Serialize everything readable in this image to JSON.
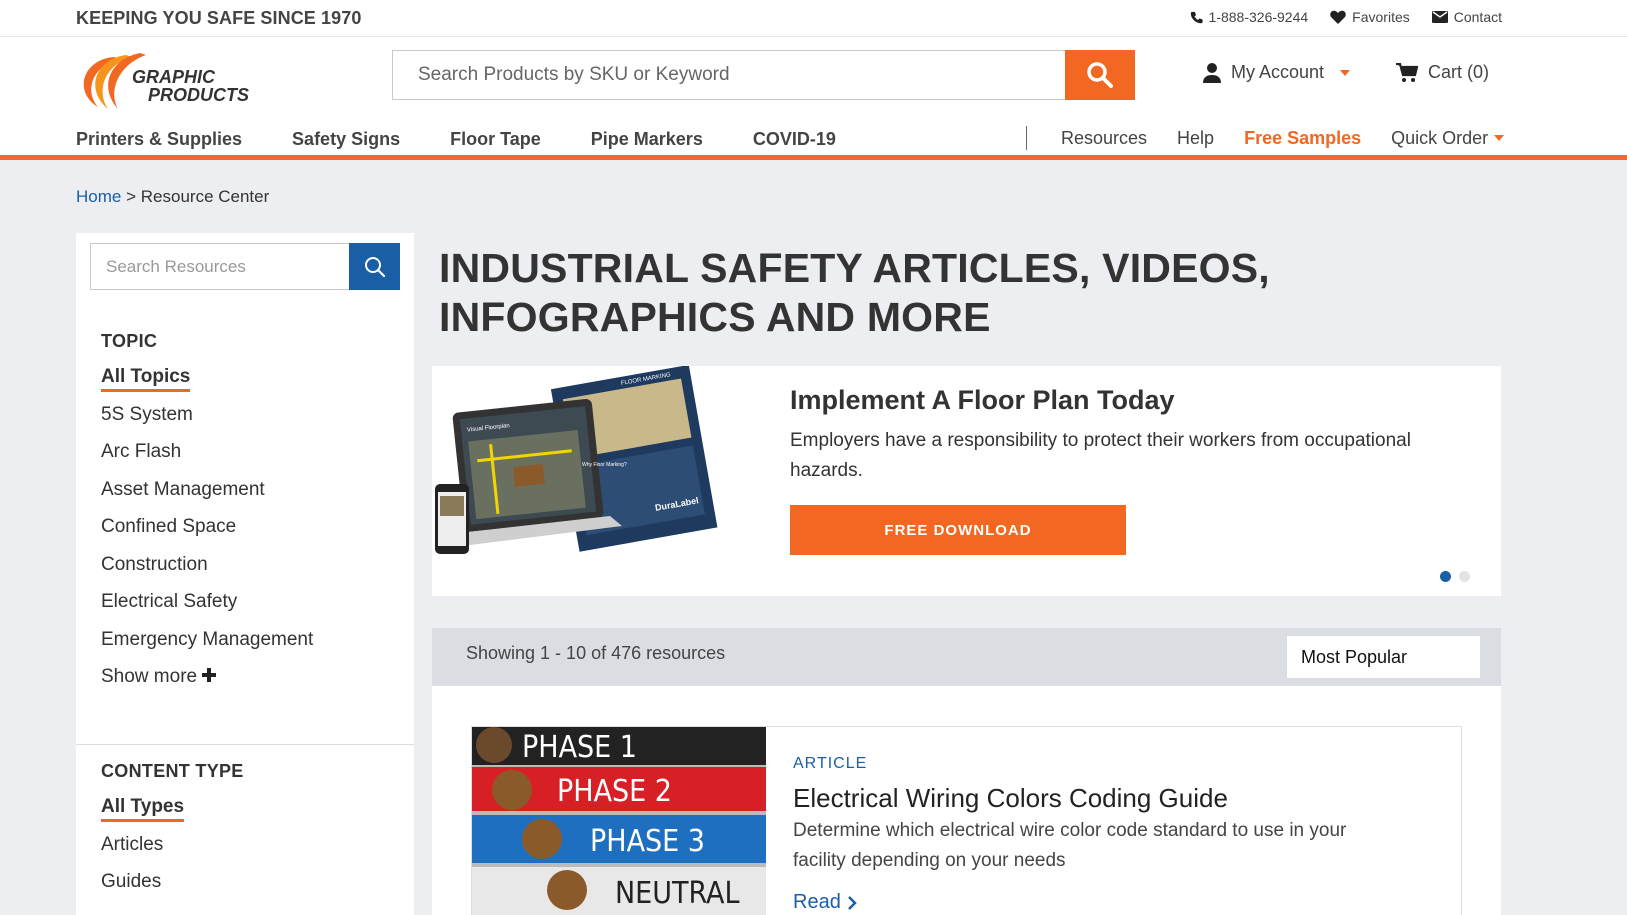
{
  "brand": {
    "tagline": "KEEPING YOU SAFE SINCE 1970",
    "logo_line1": "GRAPHIC",
    "logo_line2": "PRODUCTS",
    "accent": "#f26722",
    "link": "#1a5fa6"
  },
  "toplinks": {
    "phone": "1-888-326-9244",
    "favorites": "Favorites",
    "contact": "Contact"
  },
  "header": {
    "search_placeholder": "Search Products by SKU or Keyword",
    "account": "My Account",
    "cart": "Cart (0)"
  },
  "nav": {
    "main": [
      "Printers & Supplies",
      "Safety Signs",
      "Floor Tape",
      "Pipe Markers",
      "COVID-19"
    ],
    "secondary": [
      "Resources",
      "Help",
      "Free Samples",
      "Quick Order"
    ]
  },
  "breadcrumb": {
    "home": "Home",
    "separator": ">",
    "current": "Resource Center"
  },
  "sidebar": {
    "search_placeholder": "Search Resources",
    "topic_title": "TOPIC",
    "topics": [
      "All Topics",
      "5S System",
      "Arc Flash",
      "Asset Management",
      "Confined Space",
      "Construction",
      "Electrical Safety",
      "Emergency Management"
    ],
    "show_more": "Show more",
    "content_type_title": "CONTENT TYPE",
    "content_types": [
      "All Types",
      "Articles",
      "Guides"
    ]
  },
  "page": {
    "title": "INDUSTRIAL SAFETY ARTICLES, VIDEOS, INFOGRAPHICS AND MORE"
  },
  "promo": {
    "title": "Implement A Floor Plan Today",
    "text": "Employers have a responsibility to protect their workers from occupational hazards.",
    "button": "FREE DOWNLOAD",
    "image_labels": [
      "FLOOR MARKING",
      "Visual Floorplan",
      "DuraLabel",
      "Why Floor Marking?"
    ]
  },
  "results": {
    "count": "Showing 1 - 10 of 476 resources",
    "sort": "Most Popular"
  },
  "article": {
    "type": "ARTICLE",
    "title": "Electrical Wiring Colors Coding Guide",
    "desc": "Determine which electrical wire color code standard to use in your facility depending on your needs",
    "read": "Read",
    "image_labels": [
      "PHASE 1",
      "PHASE 2",
      "PHASE 3",
      "NEUTRAL"
    ]
  }
}
